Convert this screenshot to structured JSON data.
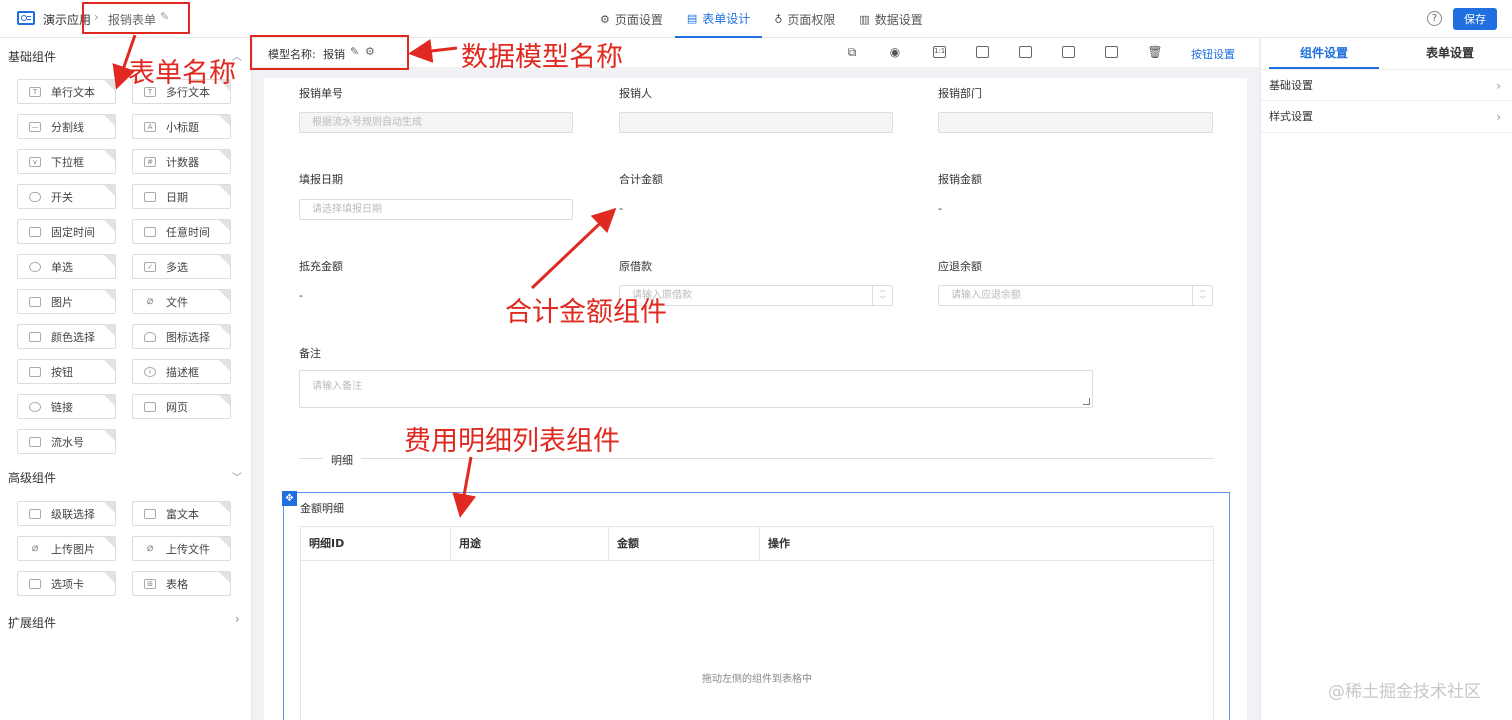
{
  "topbar": {
    "app_name": "演示应用",
    "crumb_sep": "›",
    "form_name": "报销表单",
    "tabs": [
      {
        "icon": "⚙",
        "label": "页面设置"
      },
      {
        "icon": "▤",
        "label": "表单设计"
      },
      {
        "icon": "♁",
        "label": "页面权限"
      },
      {
        "icon": "▥",
        "label": "数据设置"
      }
    ],
    "active_tab": "表单设计",
    "help": "?",
    "save_label": "保存"
  },
  "left_panel": {
    "basic_title": "基础组件",
    "basic_components": [
      "单行文本",
      "多行文本",
      "分割线",
      "小标题",
      "下拉框",
      "计数器",
      "开关",
      "日期",
      "固定时间",
      "任意时间",
      "单选",
      "多选",
      "图片",
      "文件",
      "颜色选择",
      "图标选择",
      "按钮",
      "描述框",
      "链接",
      "网页",
      "流水号"
    ],
    "advanced_title": "高级组件",
    "advanced_components": [
      "级联选择",
      "富文本",
      "上传图片",
      "上传文件",
      "选项卡",
      "表格"
    ],
    "extend_title": "扩展组件"
  },
  "canvas_header": {
    "model_label": "模型名称:",
    "model_name": "报销",
    "action_link": "按钮设置"
  },
  "form": {
    "row1": [
      {
        "label": "报销单号",
        "placeholder": "根据流水号规则自动生成"
      },
      {
        "label": "报销人",
        "placeholder": ""
      },
      {
        "label": "报销部门",
        "placeholder": ""
      }
    ],
    "row2": [
      {
        "label": "填报日期",
        "placeholder": "请选择填报日期"
      },
      {
        "label": "合计金额",
        "value": "-"
      },
      {
        "label": "报销金额",
        "value": "-"
      }
    ],
    "row3": [
      {
        "label": "抵充金额",
        "value": "-"
      },
      {
        "label": "原借款",
        "placeholder": "请输入原借款"
      },
      {
        "label": "应退余额",
        "placeholder": "请输入应退余额"
      }
    ],
    "remark": {
      "label": "备注",
      "placeholder": "请输入备注"
    },
    "divider": "明细",
    "detail_table": {
      "title": "金额明细",
      "columns": [
        "明细ID",
        "用途",
        "金额",
        "操作"
      ],
      "empty_hint": "拖动左侧的组件到表格中"
    }
  },
  "right_panel": {
    "tabs": [
      "组件设置",
      "表单设置"
    ],
    "rows": [
      "基础设置",
      "样式设置"
    ]
  },
  "annotations": {
    "form_name_note": "表单名称",
    "model_name_note": "数据模型名称",
    "sum_note": "合计金额组件",
    "detail_note": "费用明细列表组件",
    "color": "#e02a21"
  },
  "watermark": "@稀土掘金技术社区"
}
